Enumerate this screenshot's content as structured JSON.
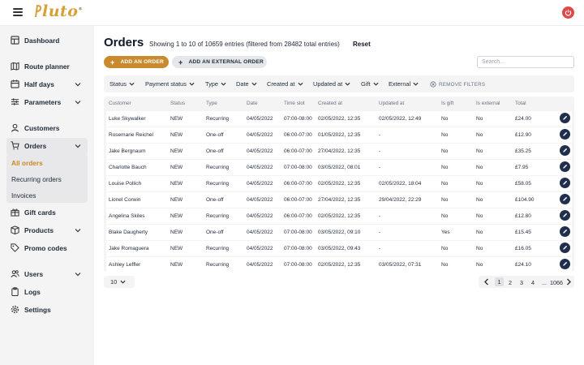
{
  "app": {
    "logo_text": "luto",
    "logo_mark": "®"
  },
  "sidebar": {
    "items": [
      {
        "label": "Dashboard"
      },
      {
        "label": "Route planner"
      },
      {
        "label": "Half days"
      },
      {
        "label": "Parameters"
      },
      {
        "label": "Customers"
      },
      {
        "label": "Orders"
      },
      {
        "label": "Gift cards"
      },
      {
        "label": "Products"
      },
      {
        "label": "Promo codes"
      },
      {
        "label": "Users"
      },
      {
        "label": "Logs"
      },
      {
        "label": "Settings"
      }
    ],
    "orders_sub": [
      "All orders",
      "Recurring orders",
      "Invoices"
    ]
  },
  "page": {
    "title": "Orders",
    "showing": "Showing 1 to 10 of 10659 entries (filtered from 28482 total entries)",
    "reset": "Reset",
    "add_order": "ADD AN ORDER",
    "add_external": "ADD AN EXTERNAL ORDER",
    "search_placeholder": "Search..."
  },
  "filters": {
    "items": [
      "Status",
      "Payment status",
      "Type",
      "Date",
      "Created at",
      "Updated at",
      "Gift",
      "External"
    ],
    "remove": "REMOVE FILTERS"
  },
  "table": {
    "columns": [
      "Customer",
      "Status",
      "Type",
      "Date",
      "Time slot",
      "Created at",
      "Updated at",
      "Is gift",
      "Is external",
      "Total"
    ],
    "rows": [
      [
        "Luke Skywalker",
        "NEW",
        "Recurring",
        "04/05/2022",
        "07:00-08:00",
        "02/05/2022, 12:35",
        "02/05/2022, 12:49",
        "No",
        "No",
        "£24.00"
      ],
      [
        "Rosemarie Reichel",
        "NEW",
        "One-off",
        "04/05/2022",
        "06:00-07:00",
        "01/05/2022, 12:35",
        "-",
        "No",
        "No",
        "£12.90"
      ],
      [
        "Jake Bergnaum",
        "NEW",
        "One-off",
        "04/05/2022",
        "06:00-07:00",
        "27/04/2022, 12:35",
        "-",
        "No",
        "No",
        "£35.25"
      ],
      [
        "Charlotte Bauch",
        "NEW",
        "Recurring",
        "04/05/2022",
        "07:00-08:00",
        "03/05/2022, 08:01",
        "-",
        "No",
        "No",
        "£7.95"
      ],
      [
        "Louise Pollich",
        "NEW",
        "Recurring",
        "04/05/2022",
        "06:00-07:00",
        "02/05/2022, 12:35",
        "02/05/2022, 18:04",
        "No",
        "No",
        "£58.05"
      ],
      [
        "Lionel Corwin",
        "NEW",
        "One-off",
        "04/05/2022",
        "06:00-07:00",
        "27/04/2022, 12:35",
        "29/04/2022, 22:29",
        "No",
        "No",
        "£104.90"
      ],
      [
        "Angelina Skiles",
        "NEW",
        "Recurring",
        "04/05/2022",
        "06:00-07:00",
        "02/05/2022, 12:35",
        "-",
        "No",
        "No",
        "£12.80"
      ],
      [
        "Blake Daugherty",
        "NEW",
        "One-off",
        "04/05/2022",
        "07:00-08:00",
        "03/05/2022, 09:10",
        "-",
        "Yes",
        "No",
        "£15.45"
      ],
      [
        "Jake Romaguera",
        "NEW",
        "Recurring",
        "04/05/2022",
        "07:00-08:00",
        "03/05/2022, 09:43",
        "-",
        "No",
        "No",
        "£16.05"
      ],
      [
        "Ashley Leffler",
        "NEW",
        "Recurring",
        "04/05/2022",
        "07:00-08:00",
        "02/05/2022, 12:35",
        "03/05/2022, 07:31",
        "No",
        "No",
        "£24.10"
      ]
    ]
  },
  "pagination": {
    "per_page": "10",
    "pages": [
      "1",
      "2",
      "3",
      "4",
      "...",
      "1066"
    ]
  },
  "colors": {
    "accent": "#c98a2e",
    "danger": "#e04848",
    "edit": "#1f2f4d"
  }
}
